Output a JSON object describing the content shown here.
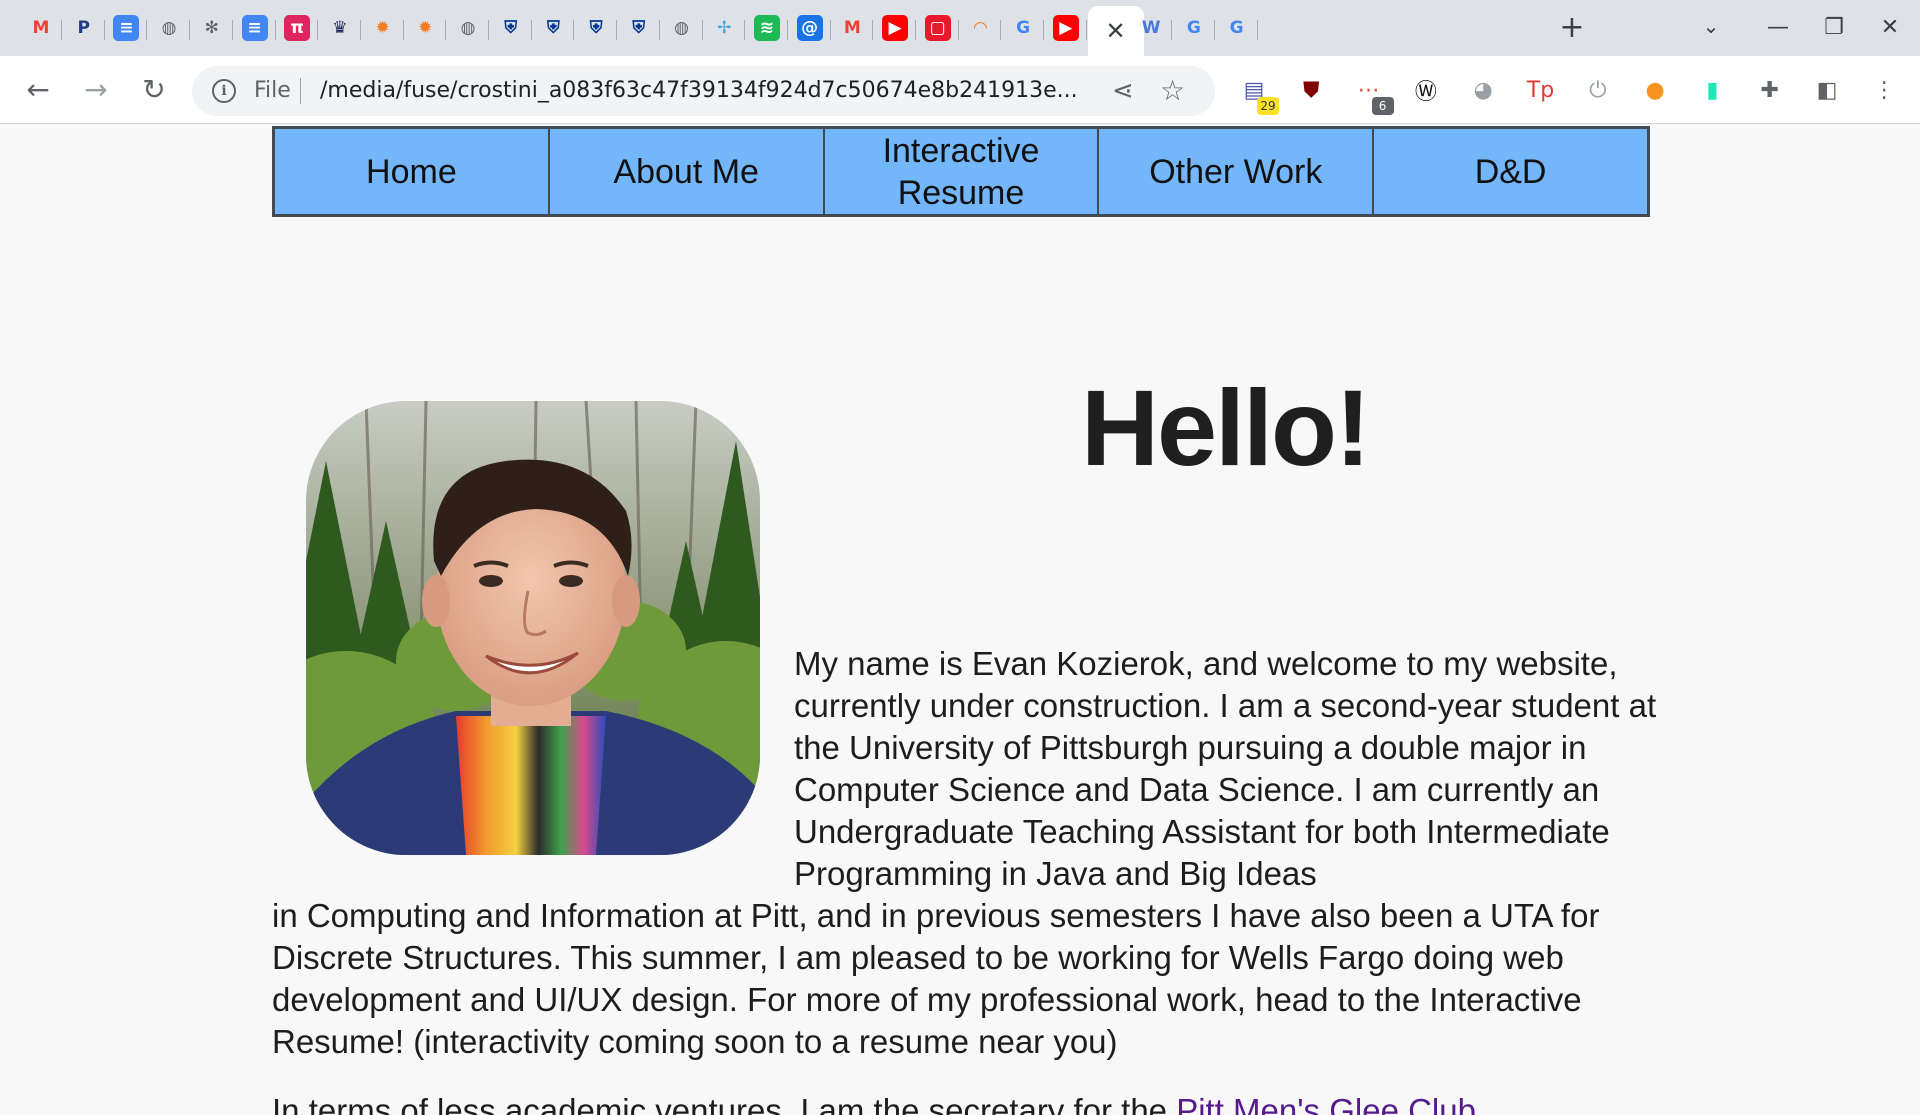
{
  "browser": {
    "tabs": [
      {
        "icon": "gmail-icon",
        "glyph": "M",
        "color": "#ea4335",
        "bg": "transparent"
      },
      {
        "icon": "paypal-icon",
        "glyph": "P",
        "color": "#1f3c88",
        "bg": "transparent"
      },
      {
        "icon": "google-docs-icon",
        "glyph": "≡",
        "color": "#ffffff",
        "bg": "#4285f4"
      },
      {
        "icon": "globe-icon",
        "glyph": "◍",
        "color": "#5f6368",
        "bg": "transparent"
      },
      {
        "icon": "settings-gear-icon",
        "glyph": "✻",
        "color": "#5f6368",
        "bg": "transparent"
      },
      {
        "icon": "google-docs-icon",
        "glyph": "≡",
        "color": "#ffffff",
        "bg": "#4285f4"
      },
      {
        "icon": "pi-app-icon",
        "glyph": "π",
        "color": "#ffffff",
        "bg": "#e0245e"
      },
      {
        "icon": "crown-icon",
        "glyph": "♛",
        "color": "#1b2a5a",
        "bg": "transparent"
      },
      {
        "icon": "orange-gear-icon",
        "glyph": "✹",
        "color": "#f47b20",
        "bg": "transparent"
      },
      {
        "icon": "orange-gear-icon",
        "glyph": "✹",
        "color": "#f47b20",
        "bg": "transparent"
      },
      {
        "icon": "globe-icon",
        "glyph": "◍",
        "color": "#5f6368",
        "bg": "transparent"
      },
      {
        "icon": "pitt-shield-icon",
        "glyph": "⛨",
        "color": "#003594",
        "bg": "transparent"
      },
      {
        "icon": "pitt-shield-icon",
        "glyph": "⛨",
        "color": "#003594",
        "bg": "transparent"
      },
      {
        "icon": "pitt-shield-icon",
        "glyph": "⛨",
        "color": "#003594",
        "bg": "transparent"
      },
      {
        "icon": "pitt-shield-icon",
        "glyph": "⛨",
        "color": "#003594",
        "bg": "transparent"
      },
      {
        "icon": "globe-icon",
        "glyph": "◍",
        "color": "#5f6368",
        "bg": "transparent"
      },
      {
        "icon": "pinwheel-icon",
        "glyph": "✢",
        "color": "#4aa3df",
        "bg": "transparent"
      },
      {
        "icon": "spotify-icon",
        "glyph": "≋",
        "color": "#ffffff",
        "bg": "#1db954"
      },
      {
        "icon": "at-sign-icon",
        "glyph": "@",
        "color": "#ffffff",
        "bg": "#1a73e8"
      },
      {
        "icon": "gmail-icon",
        "glyph": "M",
        "color": "#ea4335",
        "bg": "transparent"
      },
      {
        "icon": "youtube-icon",
        "glyph": "▶",
        "color": "#ffffff",
        "bg": "#ff0000"
      },
      {
        "icon": "red-square-icon",
        "glyph": "▢",
        "color": "#ffffff",
        "bg": "#e8192c"
      },
      {
        "icon": "loading-arc-icon",
        "glyph": "◠",
        "color": "#f47b20",
        "bg": "transparent"
      },
      {
        "icon": "google-icon",
        "glyph": "G",
        "color": "#4285f4",
        "bg": "transparent"
      },
      {
        "icon": "youtube-icon",
        "glyph": "▶",
        "color": "#ffffff",
        "bg": "#ff0000"
      },
      {
        "icon": "close-tab-icon",
        "glyph": "✕",
        "color": "#3c4043",
        "bg": "transparent",
        "active": true
      },
      {
        "icon": "wikipedia-icon",
        "glyph": "W",
        "color": "#4a7bd8",
        "bg": "transparent"
      },
      {
        "icon": "google-icon",
        "glyph": "G",
        "color": "#4285f4",
        "bg": "transparent"
      },
      {
        "icon": "google-icon",
        "glyph": "G",
        "color": "#4285f4",
        "bg": "transparent"
      }
    ],
    "new_tab_glyph": "+",
    "tab_search_glyph": "⌄",
    "window_controls": {
      "minimize": "—",
      "restore": "❐",
      "close": "✕"
    },
    "nav": {
      "back": "←",
      "forward": "→",
      "reload": "↻"
    },
    "omnibox": {
      "info_glyph": "i",
      "scheme_label": "File",
      "url": "/media/fuse/crostini_a083f63c47f39134f924d7c50674e8b241913e...",
      "share_glyph": "⋖",
      "star_glyph": "☆"
    },
    "extensions": [
      {
        "icon": "calendar-extension-icon",
        "glyph": "▤",
        "color": "#4a5aa8",
        "badge": "29",
        "badge_bg": "#fbe122",
        "badge_color": "#333333"
      },
      {
        "icon": "ublock-icon",
        "glyph": "⛊",
        "color": "#800000",
        "badge": "",
        "badge_bg": "",
        "badge_color": ""
      },
      {
        "icon": "todoist-extension-icon",
        "glyph": "⋯",
        "color": "#db4c3f",
        "badge": "6",
        "badge_bg": "#5f6368",
        "badge_color": "#ffffff"
      },
      {
        "icon": "wordtune-icon",
        "glyph": "Ⓦ",
        "color": "#111111",
        "badge": "",
        "badge_bg": "",
        "badge_color": ""
      },
      {
        "icon": "pen-extension-icon",
        "glyph": "◕",
        "color": "#9aa0a6",
        "badge": "",
        "badge_bg": "",
        "badge_color": ""
      },
      {
        "icon": "tp-extension-icon",
        "glyph": "Tp",
        "color": "#e53935",
        "badge": "",
        "badge_bg": "",
        "badge_color": ""
      },
      {
        "icon": "power-icon",
        "glyph": "⏻",
        "color": "#9aa0a6",
        "badge": "",
        "badge_bg": "",
        "badge_color": ""
      },
      {
        "icon": "honey-extension-icon",
        "glyph": "●",
        "color": "#f7931e",
        "badge": "",
        "badge_bg": "",
        "badge_color": ""
      },
      {
        "icon": "bookmark-extension-icon",
        "glyph": "▮",
        "color": "#1de9b6",
        "badge": "",
        "badge_bg": "",
        "badge_color": ""
      },
      {
        "icon": "puzzle-extensions-icon",
        "glyph": "✚",
        "color": "#5f6368",
        "badge": "",
        "badge_bg": "",
        "badge_color": ""
      },
      {
        "icon": "side-panel-icon",
        "glyph": "◧",
        "color": "#5f6368",
        "badge": "",
        "badge_bg": "",
        "badge_color": ""
      },
      {
        "icon": "kebab-menu-icon",
        "glyph": "⋮",
        "color": "#5f6368",
        "badge": "",
        "badge_bg": "",
        "badge_color": ""
      }
    ]
  },
  "site": {
    "nav": [
      "Home",
      "About Me",
      "Interactive Resume",
      "Other Work",
      "D&D"
    ],
    "heading": "Hello!",
    "photo_icon": "profile-photo",
    "intro_part1": "My name is Evan Kozierok, and welcome to my website, currently under construction. I am a second-year student at the University of Pittsburgh pursuing a double major in Computer Science and Data Science. I am currently an Undergraduate Teaching Assistant for both Intermediate Programming in Java and Big Ideas",
    "intro_part2": "in Computing and Information at Pitt, and in previous semesters I have also been a UTA for Discrete Structures. This summer, I am pleased to be working for Wells Fargo doing web development and UI/UX design. For more of my professional work, head to the Interactive Resume! (interactivity coming soon to a resume near you)",
    "second_para_text": "In terms of less academic ventures, I am the secretary for the ",
    "second_para_link": "Pitt Men's Glee Club",
    "colors": {
      "nav_bg": "#73b6f9",
      "nav_border": "#444a52",
      "link": "#551a8b",
      "page_bg": "#f8f8f8"
    }
  }
}
